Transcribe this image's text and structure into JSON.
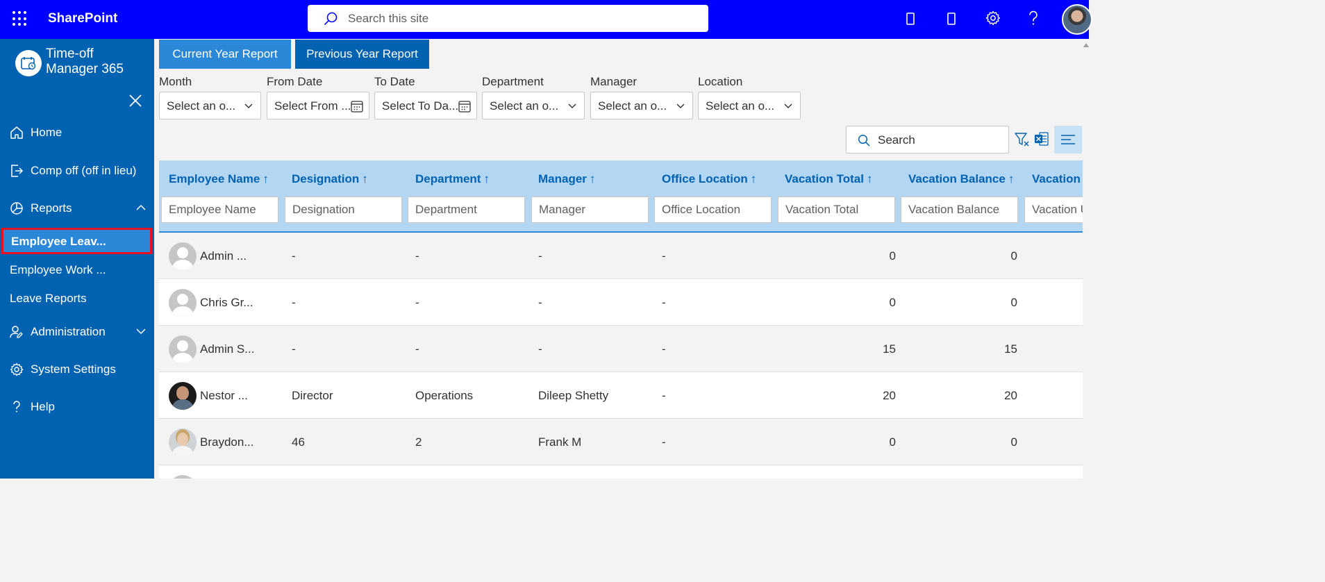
{
  "topbar": {
    "app_name": "SharePoint",
    "search_placeholder": "Search this site",
    "icons": [
      "app-launcher-icon",
      "search-icon",
      "mobile-icon",
      "mobile-icon",
      "settings-icon",
      "help-icon"
    ],
    "bg_color": "#0000ff"
  },
  "sidebar": {
    "brand": "Time-off Manager 365",
    "brand_line1": "Time-off",
    "brand_line2": "Manager 365",
    "home": "Home",
    "comp_off": "Comp off (off in lieu)",
    "reports": "Reports",
    "reports_sub": [
      "Employee Leav...",
      "Employee Work ...",
      "Leave Reports"
    ],
    "administration": "Administration",
    "system_settings": "System Settings",
    "help": "Help",
    "bg_color": "#0062b1",
    "active_color": "#2b88d8",
    "highlight_color": "#e81123"
  },
  "tabs": {
    "current": "Current Year Report",
    "previous": "Previous Year Report"
  },
  "filters": {
    "month": {
      "label": "Month",
      "value": "Select an o..."
    },
    "from_date": {
      "label": "From Date",
      "value": "Select From ..."
    },
    "to_date": {
      "label": "To Date",
      "value": "Select To Da..."
    },
    "department": {
      "label": "Department",
      "value": "Select an o..."
    },
    "manager": {
      "label": "Manager",
      "value": "Select an o..."
    },
    "location": {
      "label": "Location",
      "value": "Select an o..."
    }
  },
  "grid_search": {
    "placeholder": "Search"
  },
  "table": {
    "columns": [
      {
        "header": "Employee Name",
        "filter_placeholder": "Employee Name"
      },
      {
        "header": "Designation",
        "filter_placeholder": "Designation"
      },
      {
        "header": "Department",
        "filter_placeholder": "Department"
      },
      {
        "header": "Manager",
        "filter_placeholder": "Manager"
      },
      {
        "header": "Office Location",
        "filter_placeholder": "Office Location"
      },
      {
        "header": "Vacation Total",
        "filter_placeholder": "Vacation Total"
      },
      {
        "header": "Vacation Balance",
        "filter_placeholder": "Vacation Balance"
      },
      {
        "header": "Vacation",
        "filter_placeholder": "Vacation U"
      }
    ],
    "sort_arrow": "↑",
    "rows": [
      {
        "name": "Admin ...",
        "designation": "-",
        "department": "-",
        "manager": "-",
        "location": "-",
        "vacation_total": "0",
        "vacation_balance": "0"
      },
      {
        "name": "Chris Gr...",
        "designation": "-",
        "department": "-",
        "manager": "-",
        "location": "-",
        "vacation_total": "0",
        "vacation_balance": "0"
      },
      {
        "name": "Admin S...",
        "designation": "-",
        "department": "-",
        "manager": "-",
        "location": "-",
        "vacation_total": "15",
        "vacation_balance": "15"
      },
      {
        "name": "Nestor ...",
        "designation": "Director",
        "department": "Operations",
        "manager": "Dileep Shetty",
        "location": "-",
        "vacation_total": "20",
        "vacation_balance": "20"
      },
      {
        "name": "Braydon...",
        "designation": "46",
        "department": "2",
        "manager": "Frank M",
        "location": "-",
        "vacation_total": "0",
        "vacation_balance": "0"
      }
    ]
  }
}
